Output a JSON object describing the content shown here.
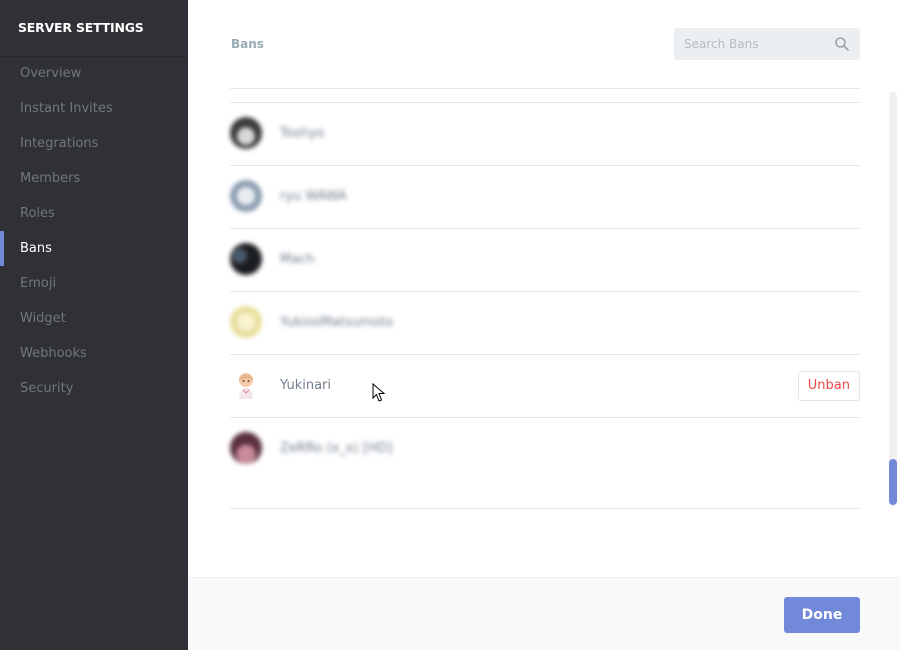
{
  "sidebar": {
    "title": "SERVER SETTINGS",
    "items": [
      {
        "label": "Overview"
      },
      {
        "label": "Instant Invites"
      },
      {
        "label": "Integrations"
      },
      {
        "label": "Members"
      },
      {
        "label": "Roles"
      },
      {
        "label": "Bans",
        "active": true
      },
      {
        "label": "Emoji"
      },
      {
        "label": "Widget"
      },
      {
        "label": "Webhooks"
      },
      {
        "label": "Security"
      }
    ]
  },
  "header": {
    "title": "Bans",
    "search_placeholder": "Search Bans",
    "search_icon": "search-icon"
  },
  "bans": [
    {
      "name": "Toshyo",
      "blurred": true,
      "avatar_color": "#3a3a3a"
    },
    {
      "name": "ryu WAWA",
      "blurred": true,
      "avatar_color": "#8a9bb0"
    },
    {
      "name": "Mach",
      "blurred": true,
      "avatar_color": "#1c1e22"
    },
    {
      "name": "YukiosMatsumoto",
      "blurred": true,
      "avatar_color": "#e8df9a"
    },
    {
      "name": "Yukinari",
      "blurred": false,
      "avatar_color": "#f3d9c4",
      "action_label": "Unban"
    },
    {
      "name": "ZeRRo (x_x) [HD]",
      "blurred": true,
      "avatar_color": "#8a4a5a"
    }
  ],
  "footer": {
    "done_label": "Done"
  },
  "colors": {
    "accent": "#7289da",
    "danger": "#f04747",
    "sidebar_bg": "#2f3136"
  }
}
